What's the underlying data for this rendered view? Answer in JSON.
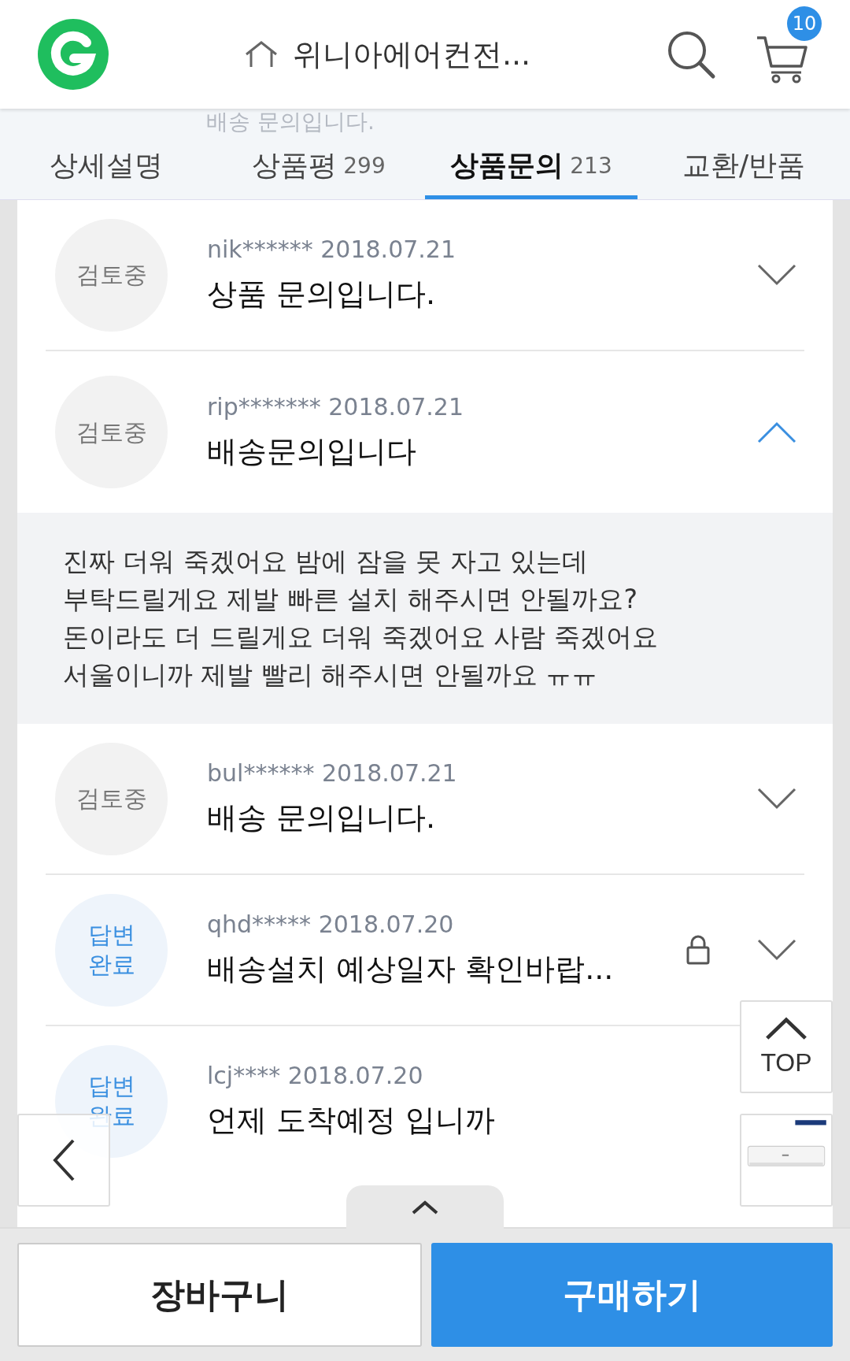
{
  "header": {
    "title": "위니아에어컨전...",
    "cart_count": "10"
  },
  "scroll_ghost": "배송 문의입니다.",
  "tabs": [
    {
      "label": "상세설명",
      "selected": false
    },
    {
      "label": "상품평",
      "count": "299",
      "selected": false
    },
    {
      "label": "상품문의",
      "count": "213",
      "selected": true
    },
    {
      "label": "교환/반품",
      "selected": false
    }
  ],
  "questions": [
    {
      "status": "검토중",
      "kind": "reviewing",
      "user": "nik******",
      "date": "2018.07.21",
      "title": "상품 문의입니다.",
      "expanded": false,
      "locked": false
    },
    {
      "status": "검토중",
      "kind": "reviewing",
      "user": "rip*******",
      "date": "2018.07.21",
      "title": "배송문의입니다",
      "expanded": true,
      "locked": false,
      "body": "진짜 더워 죽겠어요 밤에 잠을 못 자고 있는데\n부탁드릴게요 제발 빠른 설치 해주시면 안될까요?\n돈이라도 더 드릴게요 더워 죽겠어요 사람 죽겠어요\n서울이니까 제발 빨리 해주시면 안될까요 ㅠㅠ"
    },
    {
      "status": "검토중",
      "kind": "reviewing",
      "user": "bul******",
      "date": "2018.07.21",
      "title": "배송 문의입니다.",
      "expanded": false,
      "locked": false
    },
    {
      "status": "답변\n완료",
      "kind": "answered",
      "user": "qhd*****",
      "date": "2018.07.20",
      "title": "배송설치 예상일자 확인바랍...",
      "expanded": false,
      "locked": true
    },
    {
      "status": "답변\n완료",
      "kind": "answered",
      "user": "lcj****",
      "date": "2018.07.20",
      "title": "언제 도착예정 입니까",
      "expanded": false,
      "locked": false
    }
  ],
  "top_button": "TOP",
  "buttons": [
    {
      "label": "장바구니",
      "kind": "secondary"
    },
    {
      "label": "구매하기",
      "kind": "primary"
    }
  ]
}
